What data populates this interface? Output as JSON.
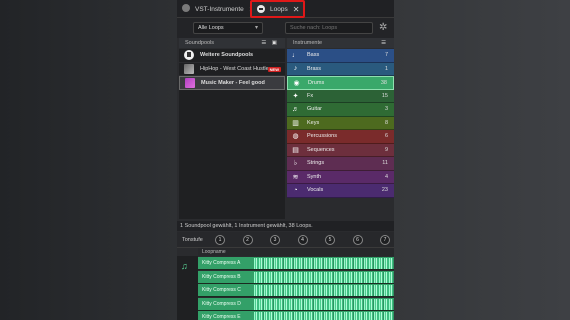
{
  "tabs": [
    {
      "label": "VST-Instrumente"
    },
    {
      "label": "Loops"
    }
  ],
  "toolbar": {
    "filter_value": "Alle Loops",
    "search_placeholder": "Suche nach: Loops"
  },
  "soundpools": {
    "header": "Soundpools",
    "items": [
      {
        "label": "Weitere Soundpools"
      },
      {
        "label": "HipHop - West Coast Hustle",
        "badge": "NEW"
      },
      {
        "label": "Music Maker - Feel good"
      }
    ]
  },
  "instruments": {
    "header": "Instrumente",
    "items": [
      {
        "label": "Bass",
        "count": "7",
        "color": "#2b4f86",
        "icon": "bass-icon"
      },
      {
        "label": "Brass",
        "count": "1",
        "color": "#2a5a7e",
        "icon": "brass-icon"
      },
      {
        "label": "Drums",
        "count": "38",
        "color": "#39a86a",
        "icon": "drums-icon"
      },
      {
        "label": "Fx",
        "count": "15",
        "color": "#2c6236",
        "icon": "fx-icon"
      },
      {
        "label": "Guitar",
        "count": "3",
        "color": "#2f6b34",
        "icon": "guitar-icon"
      },
      {
        "label": "Keys",
        "count": "8",
        "color": "#4d6a1f",
        "icon": "keys-icon"
      },
      {
        "label": "Percussions",
        "count": "6",
        "color": "#7a2b2b",
        "icon": "percussion-icon"
      },
      {
        "label": "Sequences",
        "count": "9",
        "color": "#6d2f3d",
        "icon": "sequences-icon"
      },
      {
        "label": "Strings",
        "count": "11",
        "color": "#5e2d52",
        "icon": "strings-icon"
      },
      {
        "label": "Synth",
        "count": "4",
        "color": "#5a2a68",
        "icon": "synth-icon"
      },
      {
        "label": "Vocals",
        "count": "23",
        "color": "#4b2b70",
        "icon": "vocals-icon"
      }
    ]
  },
  "status": "1 Soundpool gewählt, 1 Instrument gewählt, 38 Loops.",
  "tonstufe": {
    "label": "Tonstufe",
    "keys": [
      "1",
      "2",
      "3",
      "4",
      "5",
      "6",
      "7"
    ]
  },
  "loops": {
    "header": "Loopname",
    "items": [
      {
        "label": "Kitty Compress A"
      },
      {
        "label": "Kitty Compress B"
      },
      {
        "label": "Kitty Compress C"
      },
      {
        "label": "Kitty Compress D"
      },
      {
        "label": "Kitty Compress E"
      }
    ]
  }
}
